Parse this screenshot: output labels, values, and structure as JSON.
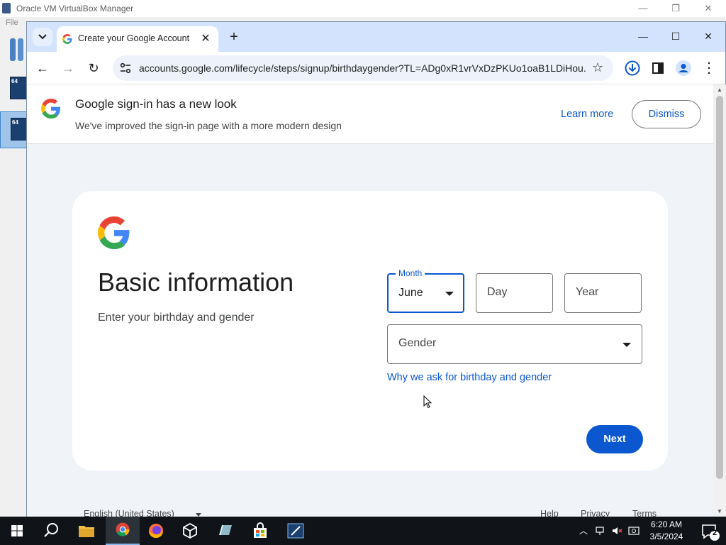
{
  "vbox": {
    "title": "Oracle VM VirtualBox Manager",
    "menu_file": "File",
    "vm_badge_1": "64",
    "vm_badge_2": "64"
  },
  "browser": {
    "tab_title": "Create your Google Account",
    "url": "accounts.google.com/lifecycle/steps/signup/birthdaygender?TL=ADg0xR1vrVxDzPKUo1oaB1LDiHou..."
  },
  "banner": {
    "title": "Google sign-in has a new look",
    "subtitle": "We've improved the sign-in page with a more modern design",
    "learn_more": "Learn more",
    "dismiss": "Dismiss"
  },
  "form": {
    "title": "Basic information",
    "subtitle": "Enter your birthday and gender",
    "month_label": "Month",
    "month_value": "June",
    "day_placeholder": "Day",
    "year_placeholder": "Year",
    "gender_placeholder": "Gender",
    "why_link": "Why we ask for birthday and gender",
    "next": "Next"
  },
  "footer": {
    "language": "English (United States)",
    "help": "Help",
    "privacy": "Privacy",
    "terms": "Terms"
  },
  "taskbar": {
    "time": "6:20 AM",
    "date": "3/5/2024",
    "notifications": "2"
  },
  "colors": {
    "accent": "#0b57d0",
    "tabstrip": "#d3e3fd",
    "page_bg": "#f0f4f9",
    "taskbar": "#101418"
  }
}
